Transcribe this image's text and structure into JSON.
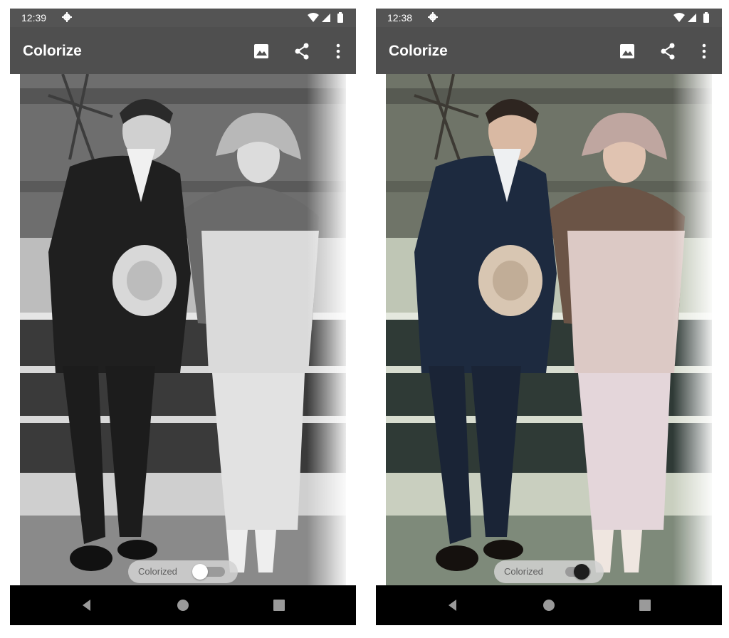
{
  "screens": [
    {
      "status_time": "12:39",
      "app_title": "Colorize",
      "toggle_label": "Colorized",
      "toggle_state": "off",
      "photo_mode": "grayscale"
    },
    {
      "status_time": "12:38",
      "app_title": "Colorize",
      "toggle_label": "Colorized",
      "toggle_state": "on",
      "photo_mode": "color"
    }
  ],
  "icons": {
    "status": [
      "settings-gear-icon",
      "wifi-icon",
      "cell-signal-icon",
      "battery-icon"
    ],
    "appbar": [
      "gallery-icon",
      "share-icon",
      "more-vert-icon"
    ],
    "navbar": [
      "back-icon",
      "home-icon",
      "recents-icon"
    ]
  },
  "colors": {
    "status_bar": "#545454",
    "app_bar": "#4f4f4f",
    "nav_bar": "#000000"
  }
}
